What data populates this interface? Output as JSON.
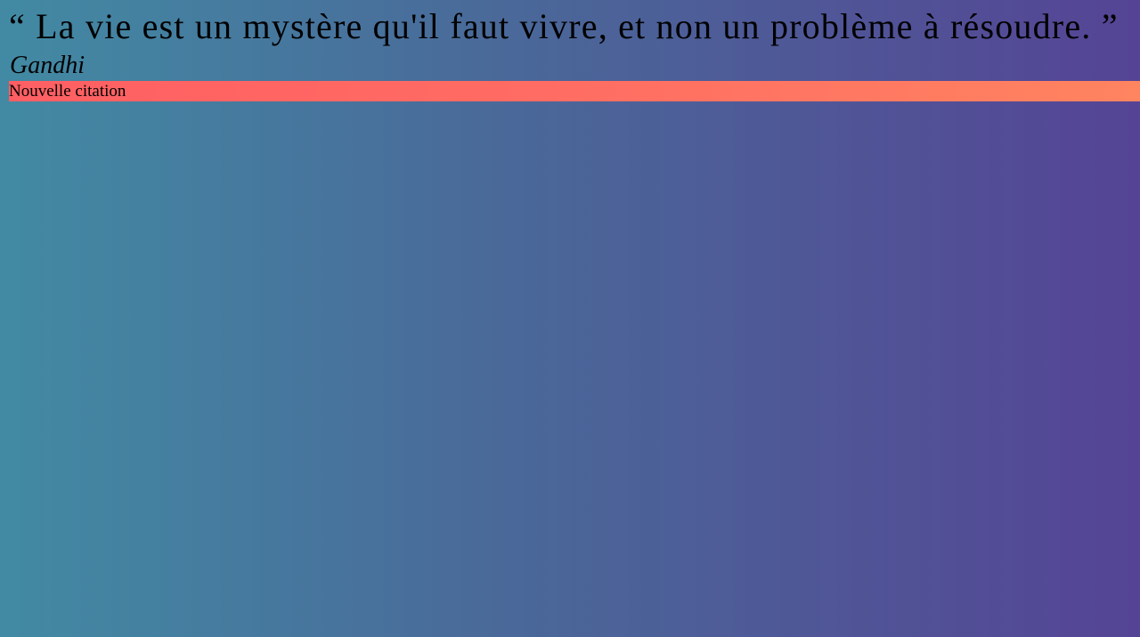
{
  "quote": {
    "open_mark": "“",
    "text": "La vie est un mystère qu'il faut vivre, et non un problème à résoudre.",
    "close_mark": "”",
    "author": "Gandhi"
  },
  "actions": {
    "new_quote_label": "Nouvelle citation"
  },
  "colors": {
    "background_start": "#428aa3",
    "background_end": "#554495",
    "button_start": "#ff5f63",
    "button_end": "#ff8460",
    "text": "#000000"
  }
}
